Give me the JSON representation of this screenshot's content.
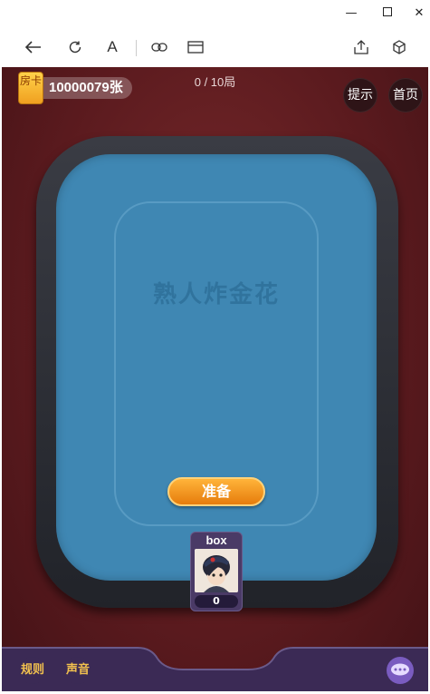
{
  "window": {
    "minimize_glyph": "—",
    "maximize_glyph": "☐",
    "close_glyph": "✕"
  },
  "toolbar": {
    "icons": [
      "back-icon",
      "refresh-icon",
      "font-icon",
      "link-icon",
      "window-icon",
      "share-icon",
      "cube-icon"
    ],
    "font_label": "A"
  },
  "game": {
    "room_card_label": "房卡",
    "room_card_count": "10000079张",
    "round": "0 / 10局",
    "hint_button": "提示",
    "home_button": "首页",
    "table_logo": "熟人炸金花",
    "ready_button": "准备",
    "player": {
      "name": "box",
      "score": "0"
    },
    "rules_button": "规则",
    "sound_button": "声音"
  },
  "colors": {
    "felt": "#3f87b3",
    "background": "#5a1a1e",
    "accent": "#f0a020"
  }
}
